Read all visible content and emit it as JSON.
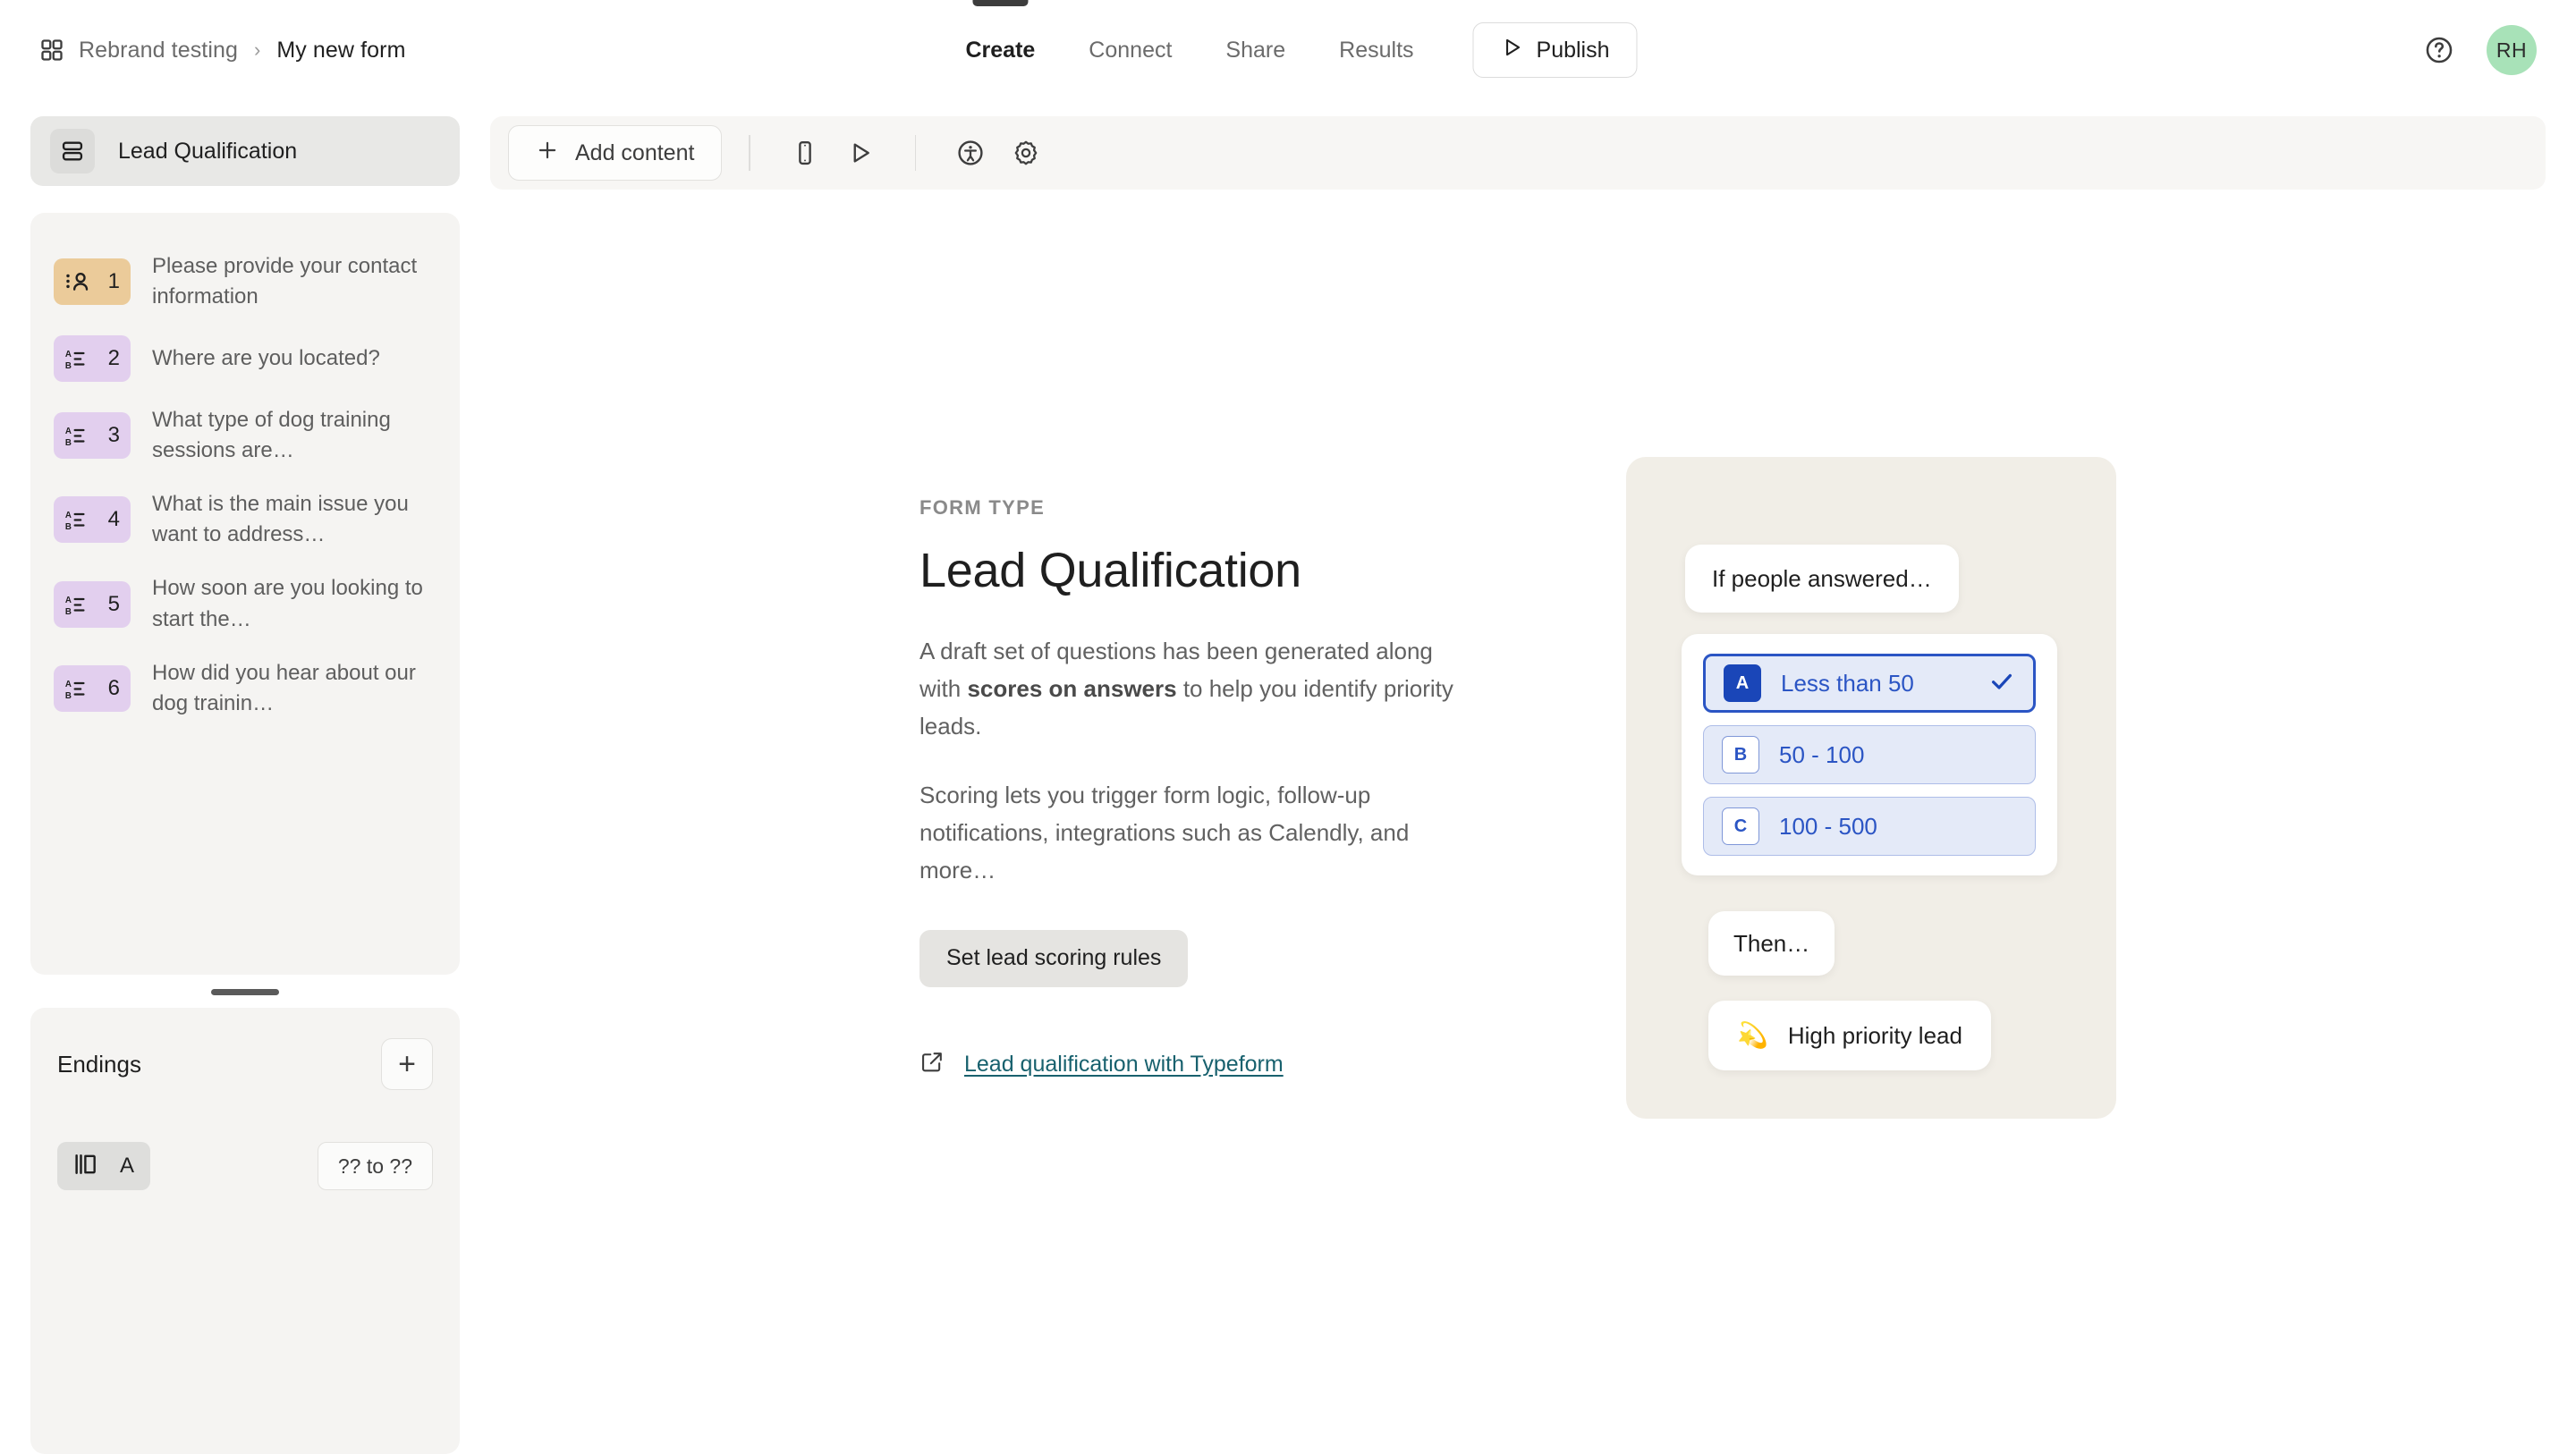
{
  "header": {
    "breadcrumb": {
      "grid_icon": "grid-icon",
      "workspace": "Rebrand testing",
      "separator": "›",
      "form": "My new form"
    },
    "tabs": [
      {
        "label": "Create",
        "active": true
      },
      {
        "label": "Connect",
        "active": false
      },
      {
        "label": "Share",
        "active": false
      },
      {
        "label": "Results",
        "active": false
      }
    ],
    "publish": {
      "label": "Publish",
      "icon": "publish-play-icon"
    },
    "help_icon": "help-circle-icon",
    "avatar": {
      "initials": "RH",
      "color": "#a8e2b8"
    }
  },
  "sidebar": {
    "group": {
      "title": "Lead Qualification",
      "icon": "form-group-icon"
    },
    "questions": [
      {
        "num": "1",
        "icon": "contact-info-icon",
        "type": "contact",
        "title": "Please provide your contact information"
      },
      {
        "num": "2",
        "icon": "multiple-choice-icon",
        "type": "choice",
        "title": "Where are you located?"
      },
      {
        "num": "3",
        "icon": "multiple-choice-icon",
        "type": "choice",
        "title": "What type of dog training sessions are…"
      },
      {
        "num": "4",
        "icon": "multiple-choice-icon",
        "type": "choice",
        "title": "What is the main issue you want to address…"
      },
      {
        "num": "5",
        "icon": "multiple-choice-icon",
        "type": "choice",
        "title": "How soon are you looking to start the…"
      },
      {
        "num": "6",
        "icon": "multiple-choice-icon",
        "type": "choice",
        "title": "How did you hear about our dog trainin…"
      }
    ],
    "endings": {
      "title": "Endings",
      "add_label": "+",
      "items": [
        {
          "icon": "ending-screen-icon",
          "letter": "A",
          "range": "?? to ??"
        }
      ]
    }
  },
  "toolbar": {
    "add_content": {
      "label": "Add content",
      "icon": "plus-icon"
    },
    "icons": [
      {
        "name": "mobile-preview-icon"
      },
      {
        "name": "preview-play-icon"
      },
      {
        "name": "accessibility-icon"
      },
      {
        "name": "settings-gear-icon"
      }
    ]
  },
  "main": {
    "eyebrow": "FORM TYPE",
    "title": "Lead Qualification",
    "paragraph_1_a": "A draft set of questions has been generated along with ",
    "paragraph_1_bold": "scores on answers",
    "paragraph_1_b": " to help you identify priority leads.",
    "paragraph_2": "Scoring lets you trigger form logic, follow-up notifications, integrations such as Calendly, and more…",
    "scoring_button": "Set lead scoring rules",
    "doc_link": {
      "label": "Lead qualification with Typeform",
      "icon": "external-link-icon"
    }
  },
  "illustration": {
    "if_bubble": "If people answered…",
    "options": [
      {
        "key": "A",
        "label": "Less than 50",
        "selected": true
      },
      {
        "key": "B",
        "label": "50 - 100",
        "selected": false
      },
      {
        "key": "C",
        "label": "100 - 500",
        "selected": false
      }
    ],
    "then_bubble": "Then…",
    "result_bubble": {
      "emoji": "💫",
      "label": "High priority lead"
    },
    "colors": {
      "card_bg": "#f1eee7",
      "option_fill": "#e4eaf8",
      "option_border": "#aebde8",
      "option_selected_border": "#2b55c4",
      "option_text": "#2b55c4",
      "option_key_selected_bg": "#1a46b8"
    }
  }
}
